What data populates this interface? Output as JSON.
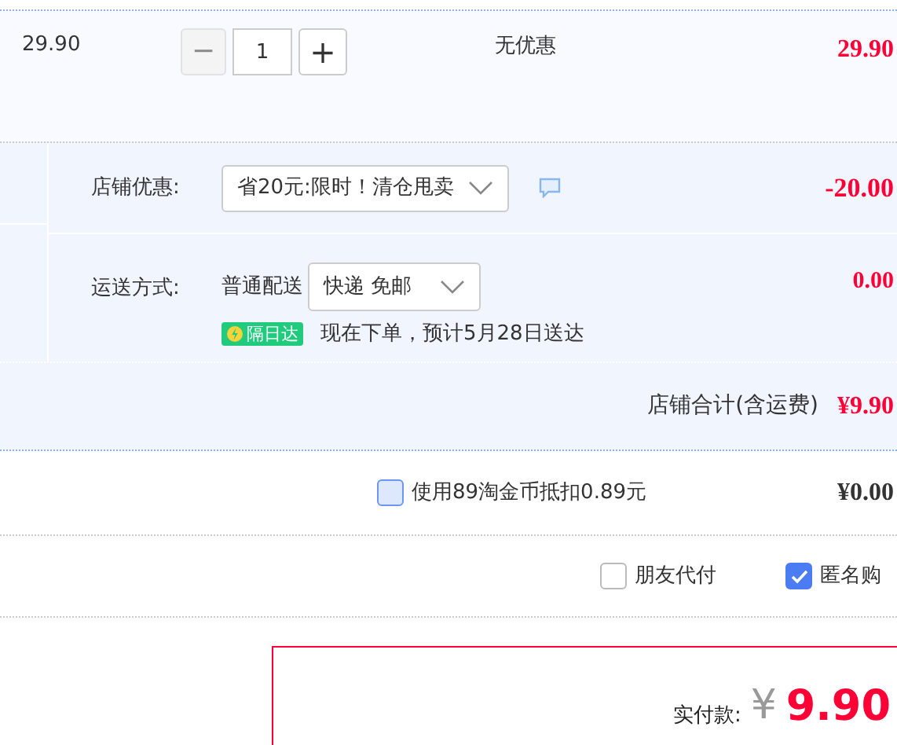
{
  "item": {
    "unit_price": "29.90",
    "quantity": {
      "minus": "−",
      "value": "1",
      "plus": "+",
      "minus_disabled": true
    },
    "discount": "无优惠",
    "subtotal": "29.90"
  },
  "shop_discount": {
    "label": "店铺优惠:",
    "value": "省20元:限时！清仓甩卖",
    "amount": "-20.00"
  },
  "shipping": {
    "label": "运送方式:",
    "method": "普通配送",
    "value": "快递 免邮",
    "badge": "隔日达",
    "note": "现在下单，预计5月28日送达",
    "amount": "0.00"
  },
  "shop_total": {
    "label": "店铺合计(含运费)",
    "amount": "¥9.90"
  },
  "coins": {
    "label": "使用89淘金币抵扣0.89元",
    "checked": false,
    "amount": "¥0.00"
  },
  "options": [
    {
      "label": "朋友代付",
      "checked": false
    },
    {
      "label": "匿名购",
      "checked": true
    }
  ],
  "payment": {
    "label": "实付款:",
    "currency": "¥",
    "amount": "9.90"
  }
}
